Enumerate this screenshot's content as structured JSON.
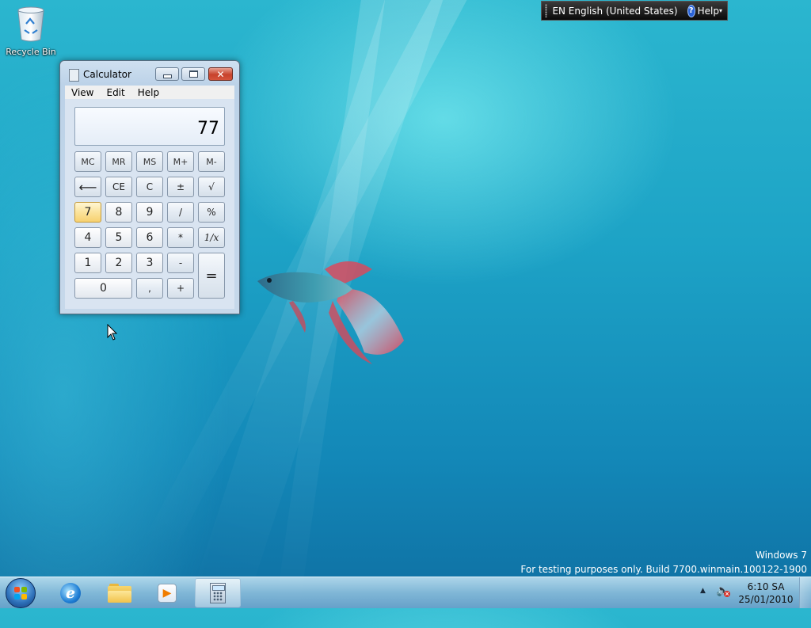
{
  "desktop": {
    "recycle_bin_label": "Recycle Bin"
  },
  "language_bar": {
    "language": "EN English (United States)",
    "help": "Help"
  },
  "calculator": {
    "title": "Calculator",
    "menu": [
      "View",
      "Edit",
      "Help"
    ],
    "display_value": "77",
    "keys": {
      "mc": "MC",
      "mr": "MR",
      "ms": "MS",
      "mplus": "M+",
      "mminus": "M-",
      "back": "⟵",
      "ce": "CE",
      "c": "C",
      "plusminus": "±",
      "sqrt": "√",
      "k7": "7",
      "k8": "8",
      "k9": "9",
      "div": "/",
      "pct": "%",
      "k4": "4",
      "k5": "5",
      "k6": "6",
      "mul": "*",
      "recip": "1/x",
      "k1": "1",
      "k2": "2",
      "k3": "3",
      "sub": "-",
      "eq": "=",
      "k0": "0",
      "dec": ",",
      "add": "+"
    },
    "highlighted_key": "7"
  },
  "watermark": {
    "line1": "Windows 7",
    "line2": "For testing purposes only. Build 7700.winmain.100122-1900"
  },
  "taskbar": {
    "pinned": [
      {
        "icon": "internet-explorer-icon"
      },
      {
        "icon": "windows-explorer-icon"
      },
      {
        "icon": "media-player-icon"
      },
      {
        "icon": "calculator-icon",
        "active": true
      }
    ],
    "clock_time": "6:10 SA",
    "clock_date": "25/01/2010"
  },
  "colors": {
    "desktop_top": "#2bb6cf",
    "desktop_bottom": "#0f6fa2",
    "close_button": "#c7422c",
    "highlight_key": "#fbe39c"
  }
}
